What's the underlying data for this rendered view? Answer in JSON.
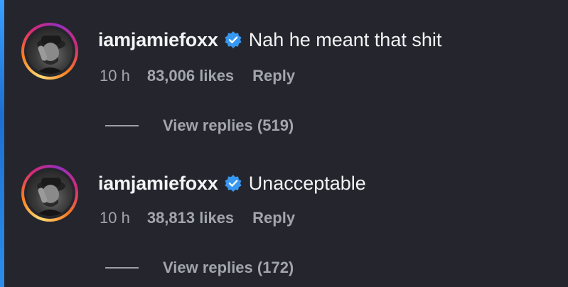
{
  "comments": [
    {
      "username": "iamjamiefoxx",
      "text": "Nah he meant that shit",
      "time": "10 h",
      "likes": "83,006 likes",
      "reply_label": "Reply",
      "view_replies": "View replies (519)"
    },
    {
      "username": "iamjamiefoxx",
      "text": "Unacceptable",
      "time": "10 h",
      "likes": "38,813 likes",
      "reply_label": "Reply",
      "view_replies": "View replies (172)"
    }
  ],
  "icons": {
    "verified": "verified-badge-icon",
    "avatar": "profile-avatar"
  },
  "colors": {
    "background": "#25262d",
    "text_primary": "#f2f3f5",
    "text_secondary": "#a2a5ad",
    "verified_blue": "#3897f0"
  }
}
